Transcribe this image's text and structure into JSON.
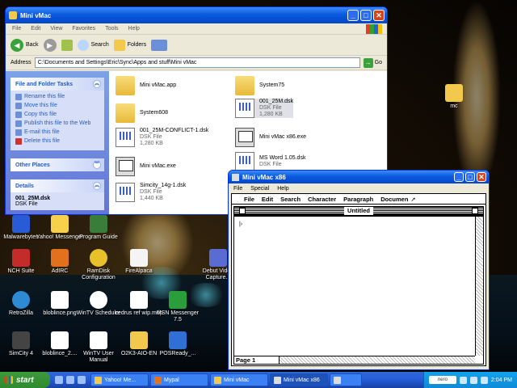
{
  "explorer": {
    "title": "Mini vMac",
    "menu": [
      "File",
      "Edit",
      "View",
      "Favorites",
      "Tools",
      "Help"
    ],
    "toolbar": {
      "back": "Back",
      "search": "Search",
      "folders": "Folders"
    },
    "address": {
      "label": "Address",
      "value": "C:\\Documents and Settings\\Eric\\Sync\\Apps and stuff\\Mini vMac",
      "go": "Go"
    },
    "tasks_header": "File and Folder Tasks",
    "tasks": [
      "Rename this file",
      "Move this file",
      "Copy this file",
      "Publish this file to the Web",
      "E-mail this file",
      "Delete this file"
    ],
    "other_places": "Other Places",
    "details_header": "Details",
    "details_name": "001_25M.dsk",
    "details_type": "DSK File",
    "files": [
      {
        "name": "Mini vMac.app",
        "type": "",
        "size": ""
      },
      {
        "name": "System75",
        "type": "",
        "size": ""
      },
      {
        "name": "System608",
        "type": "",
        "size": ""
      },
      {
        "name": "001_25M.dsk",
        "type": "DSK File",
        "size": "1,280 KB"
      },
      {
        "name": "001_25M-CONFLICT-1.dsk",
        "type": "DSK File",
        "size": "1,280 KB"
      },
      {
        "name": "Mini vMac x86.exe",
        "type": "",
        "size": ""
      },
      {
        "name": "Mini vMac.exe",
        "type": "",
        "size": ""
      },
      {
        "name": "MS Word 1.05.dsk",
        "type": "DSK File",
        "size": ""
      },
      {
        "name": "Simcity_14g-1.dsk",
        "type": "DSK File",
        "size": "1,440 KB"
      }
    ]
  },
  "minivmac": {
    "title": "Mini vMac x86",
    "menu": [
      "File",
      "Special",
      "Help"
    ],
    "mac_menu": [
      "File",
      "Edit",
      "Search",
      "Character",
      "Paragraph",
      "Documen"
    ],
    "doc_title": "Untitled",
    "page_label": "Page 1"
  },
  "desktop": {
    "icons": [
      "Malwarebytes",
      "Yahoo! Messenger",
      "Program Guide",
      "NCH Suite",
      "AdIRC",
      "RamDisk Configuration",
      "FireAlpaca",
      "Debut Video Capture...",
      "RetroZilla",
      "bloblince.png",
      "WinTV Scheduler",
      "cedrus ref wip.mdp",
      "MSN Messenger 7.5",
      "SimCity 4",
      "bloblince_2....",
      "WinTV User Manual",
      "O2K3-AIO-EN",
      "POSReady_...",
      "mc"
    ]
  },
  "taskbar": {
    "start": "start",
    "items": [
      "Yahoo! Me...",
      "Mypal",
      "Mini vMac",
      "Mini vMac x86",
      "",
      ""
    ],
    "clock": "2:04 PM",
    "tray_label": "nero"
  },
  "colors": {
    "xp_blue": "#0a5ae0",
    "start_green": "#2e8b2e",
    "taskbar": "#245edb"
  }
}
